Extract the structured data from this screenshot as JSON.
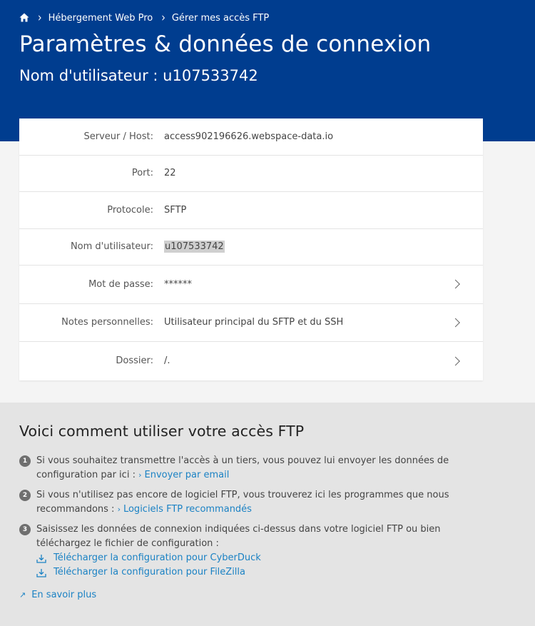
{
  "breadcrumb": {
    "items": [
      "Hébergement Web Pro",
      "Gérer mes accès FTP"
    ]
  },
  "header": {
    "title": "Paramètres & données de connexion",
    "subtitle": "Nom d'utilisateur : u107533742"
  },
  "details": [
    {
      "label": "Serveur / Host:",
      "value": "access902196626.webspace-data.io"
    },
    {
      "label": "Port:",
      "value": "22"
    },
    {
      "label": "Protocole:",
      "value": "SFTP"
    },
    {
      "label": "Nom d'utilisateur:",
      "value": "u107533742"
    },
    {
      "label": "Mot de passe:",
      "value": "******"
    },
    {
      "label": "Notes personnelles:",
      "value": "Utilisateur principal du SFTP et du SSH"
    },
    {
      "label": "Dossier:",
      "value": "/."
    }
  ],
  "help": {
    "title": "Voici comment utiliser votre accès FTP",
    "steps": [
      {
        "num": "1",
        "text": "Si vous souhaitez transmettre l'accès à un tiers, vous pouvez lui envoyer les données de configuration par ici :",
        "link": "Envoyer par email"
      },
      {
        "num": "2",
        "text": "Si vous n'utilisez pas encore de logiciel FTP, vous trouverez ici les programmes que nous recommandons :",
        "link": "Logiciels FTP recommandés"
      },
      {
        "num": "3",
        "text": "Saisissez les données de connexion indiquées ci-dessus dans votre logiciel FTP ou bien téléchargez le fichier de configuration :",
        "downloads": [
          "Télécharger la configuration pour CyberDuck",
          "Télécharger la configuration pour FileZilla"
        ]
      }
    ],
    "more": "En savoir plus"
  },
  "colors": {
    "header_bg": "#003d8f",
    "link": "#1b82c4",
    "help_bg": "#e4e4e4"
  }
}
